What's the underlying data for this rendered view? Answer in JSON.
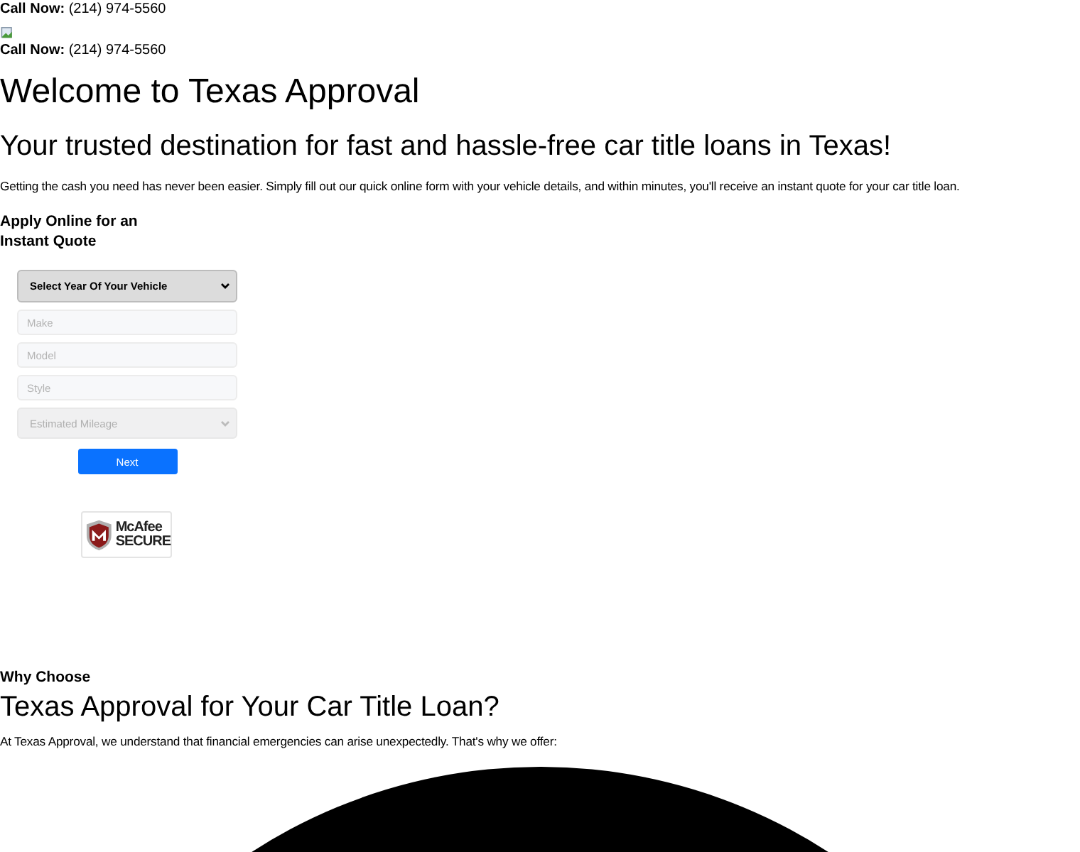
{
  "header": {
    "call_label": "Call Now:",
    "phone": "(214) 974-5560"
  },
  "header_repeat": {
    "call_label": "Call Now:",
    "phone": "(214) 974-5560"
  },
  "title": "Welcome to Texas Approval",
  "subtitle": "Your trusted destination for fast and hassle-free car title loans in Texas!",
  "intro": "Getting the cash you need has never been easier. Simply fill out our quick online form with your vehicle details, and within minutes, you'll receive an instant quote for your car title loan.",
  "form": {
    "heading_lines": [
      "Apply Online for an",
      "Instant Quote"
    ],
    "fields": [
      {
        "kind": "select",
        "value": "Select Year Of Your Vehicle",
        "disabled": false
      },
      {
        "kind": "input",
        "placeholder": "Make"
      },
      {
        "kind": "input",
        "placeholder": "Model"
      },
      {
        "kind": "input",
        "placeholder": "Style"
      },
      {
        "kind": "select",
        "value": "Estimated Mileage",
        "disabled": true
      }
    ],
    "submit": "Next"
  },
  "badge": {
    "brand": "McAfee",
    "label": "SECURE"
  },
  "why": {
    "kicker": "Why Choose",
    "heading": "Texas Approval for Your Car Title Loan?",
    "text": "At Texas Approval, we understand that financial emergencies can arise unexpectedly. That's why we offer:"
  }
}
